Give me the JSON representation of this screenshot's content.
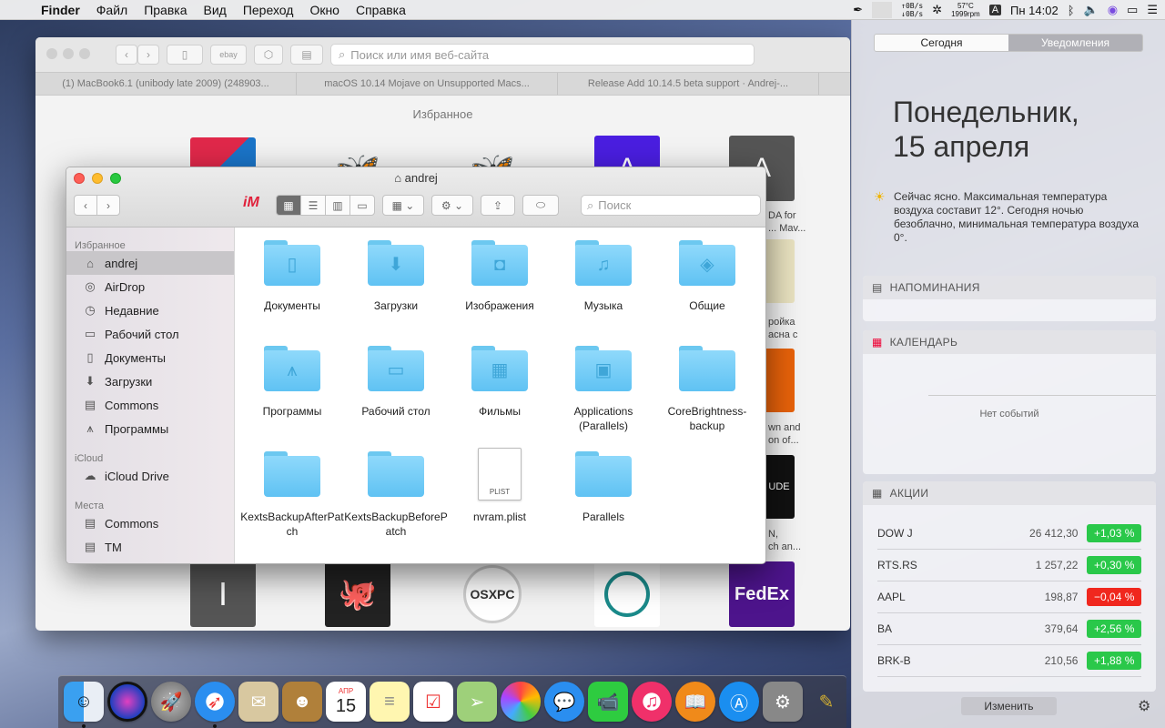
{
  "menubar": {
    "app": "Finder",
    "items": [
      "Файл",
      "Правка",
      "Вид",
      "Переход",
      "Окно",
      "Справка"
    ],
    "net_up": "0B/s",
    "net_down": "0B/s",
    "temp": "57°C",
    "fan": "1999rpm",
    "input": "A",
    "clock": "Пн 14:02"
  },
  "safari": {
    "url_placeholder": "Поиск или имя веб-сайта",
    "tabs": [
      "(1) MacBook6.1 (unibody late 2009) (248903...",
      "macOS 10.14 Mojave on Unsupported Macs...",
      "Release Add 10.14.5 beta support · Andrej-..."
    ],
    "favorites_title": "Избранное",
    "fav_labels": [
      "DA for",
      "... Mav...",
      "ройка",
      "асна с",
      "wn and",
      "on of...",
      "N,",
      "ch an..."
    ],
    "fav_tile_texts": [
      "A",
      "A",
      "I",
      "OSXPC",
      "FedEx",
      "UDE"
    ]
  },
  "finder": {
    "title": "andrej",
    "search_placeholder": "Поиск",
    "sidebar": {
      "favorites": "Избранное",
      "icloud": "iCloud",
      "places": "Места",
      "items": [
        "andrej",
        "AirDrop",
        "Недавние",
        "Рабочий стол",
        "Документы",
        "Загрузки",
        "Commons",
        "Программы"
      ],
      "icloud_items": [
        "iCloud Drive"
      ],
      "place_items": [
        "Commons",
        "TM"
      ]
    },
    "files": [
      "Документы",
      "Загрузки",
      "Изображения",
      "Музыка",
      "Общие",
      "Программы",
      "Рабочий стол",
      "Фильмы",
      "Applications (Parallels)",
      "CoreBrightness-backup",
      "KextsBackupAfterPatch",
      "KextsBackupBeforePatch",
      "nvram.plist",
      "Parallels"
    ],
    "plist_badge": "PLIST"
  },
  "nc": {
    "tab_today": "Сегодня",
    "tab_notifications": "Уведомления",
    "day": "Понедельник,",
    "date": "15 апреля",
    "weather": "Сейчас ясно. Максимальная температура воздуха составит 12°. Сегодня ночью безоблачно, минимальная температура воздуха 0°.",
    "reminders": "НАПОМИНАНИЯ",
    "calendar": "КАЛЕНДАРЬ",
    "no_events": "Нет событий",
    "stocks_title": "АКЦИИ",
    "stocks": [
      {
        "sym": "DOW J",
        "price": "26 412,30",
        "chg": "+1,03 %",
        "color": "#2ac84a"
      },
      {
        "sym": "RTS.RS",
        "price": "1 257,22",
        "chg": "+0,30 %",
        "color": "#2ac84a"
      },
      {
        "sym": "AAPL",
        "price": "198,87",
        "chg": "−0,04 %",
        "color": "#f0271e"
      },
      {
        "sym": "BA",
        "price": "379,64",
        "chg": "+2,56 %",
        "color": "#2ac84a"
      },
      {
        "sym": "BRK-B",
        "price": "210,56",
        "chg": "+1,88 %",
        "color": "#2ac84a"
      }
    ],
    "edit": "Изменить"
  },
  "dock": {
    "calendar_month": "АПР",
    "calendar_day": "15",
    "apps": [
      "finder-icon",
      "siri-icon",
      "launchpad-icon",
      "safari-icon",
      "mail-icon",
      "contacts-icon",
      "calendar-icon",
      "notes-icon",
      "reminders-icon",
      "maps-icon",
      "photos-icon",
      "messages-icon",
      "facetime-icon",
      "music-icon",
      "books-icon",
      "appstore-icon",
      "preferences-icon",
      "editor-icon"
    ]
  }
}
